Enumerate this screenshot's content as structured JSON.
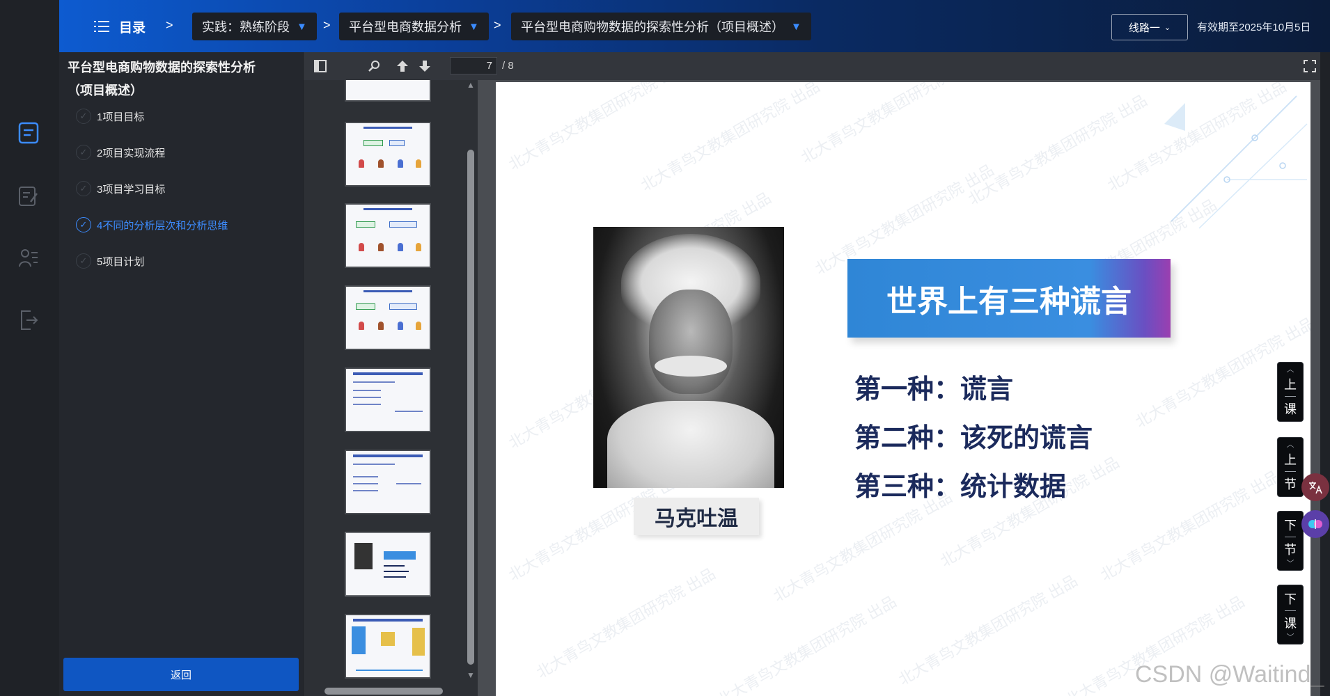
{
  "topbar": {
    "toc_label": "目录",
    "separator": ">",
    "crumbs": [
      "实践：熟练阶段",
      "平台型电商数据分析",
      "平台型电商购物数据的探索性分析（项目概述）"
    ],
    "route_label": "线路一",
    "expiry": "有效期至2025年10月5日"
  },
  "outline": {
    "title": "平台型电商购物数据的探索性分析（项目概述）",
    "items": [
      {
        "label": "1项目目标",
        "active": false
      },
      {
        "label": "2项目实现流程",
        "active": false
      },
      {
        "label": "3项目学习目标",
        "active": false
      },
      {
        "label": "4不同的分析层次和分析思维",
        "active": true
      },
      {
        "label": "5项目计划",
        "active": false
      }
    ],
    "back_label": "返回"
  },
  "pdf": {
    "current_page": "7",
    "total_pages": "/ 8"
  },
  "slide": {
    "title": "世界上有三种谎言",
    "lines": [
      "第一种：谎言",
      "第二种：该死的谎言",
      "第三种：统计数据"
    ],
    "person_name": "马克吐温",
    "watermark": "北大青鸟文教集团研究院 出品"
  },
  "side_nav": {
    "prev_lesson": [
      "上",
      "课"
    ],
    "prev_section": [
      "上",
      "节"
    ],
    "next_section": [
      "下",
      "节"
    ],
    "next_lesson": [
      "下",
      "课"
    ]
  },
  "footer_watermark": "CSDN @Waitind_"
}
